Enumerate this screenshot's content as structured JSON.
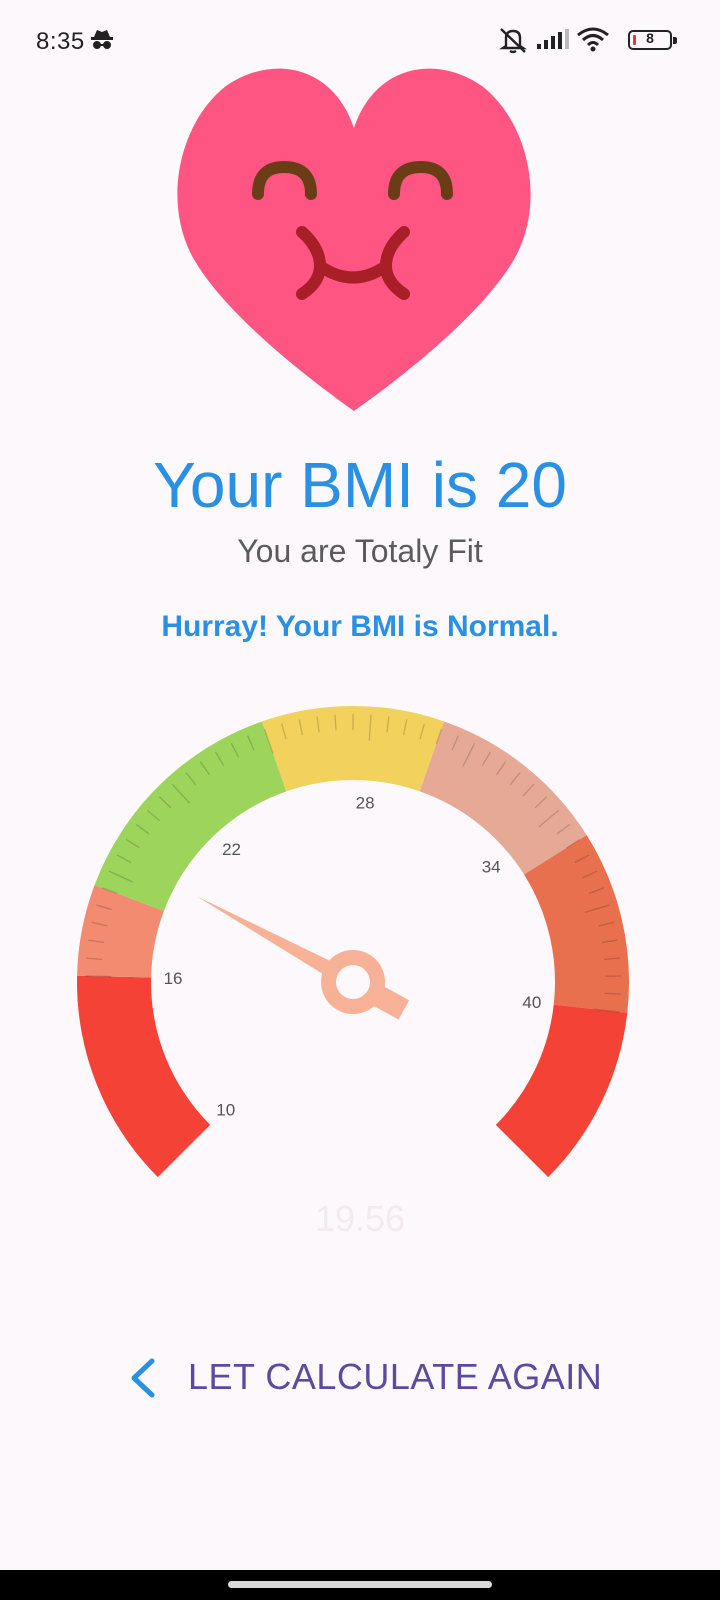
{
  "status_bar": {
    "time": "8:35",
    "battery_level": "8",
    "icons": [
      "incognito-icon",
      "mute-icon",
      "signal-icon",
      "wifi-icon",
      "battery-icon"
    ]
  },
  "result": {
    "title": "Your BMI is 20",
    "subtitle": "You are Totaly Fit",
    "message": "Hurray! Your BMI is Normal.",
    "mascot_icon": "happy-heart-icon"
  },
  "gauge": {
    "value_label": "19.56",
    "pointer_value": 19.56,
    "ticks": [
      "10",
      "16",
      "22",
      "28",
      "34",
      "40"
    ],
    "ranges": [
      {
        "from": 10,
        "to": 16,
        "color": "#f44336"
      },
      {
        "from": 16,
        "to": 18.5,
        "color": "#f28b6f"
      },
      {
        "from": 18.5,
        "to": 25,
        "color": "#9cd45c"
      },
      {
        "from": 25,
        "to": 30,
        "color": "#f2d15c"
      },
      {
        "from": 30,
        "to": 35,
        "color": "#e5a996"
      },
      {
        "from": 35,
        "to": 40,
        "color": "#e8704f"
      },
      {
        "from": 40,
        "to": 45,
        "color": "#f44336"
      }
    ],
    "pointer_color": "#f7b196"
  },
  "action": {
    "label": "LET CALCULATE AGAIN",
    "icon": "chevron-left-icon"
  },
  "colors": {
    "accent": "#2990e4",
    "button_text": "#5d4aa0",
    "heart": "#ff5582"
  }
}
